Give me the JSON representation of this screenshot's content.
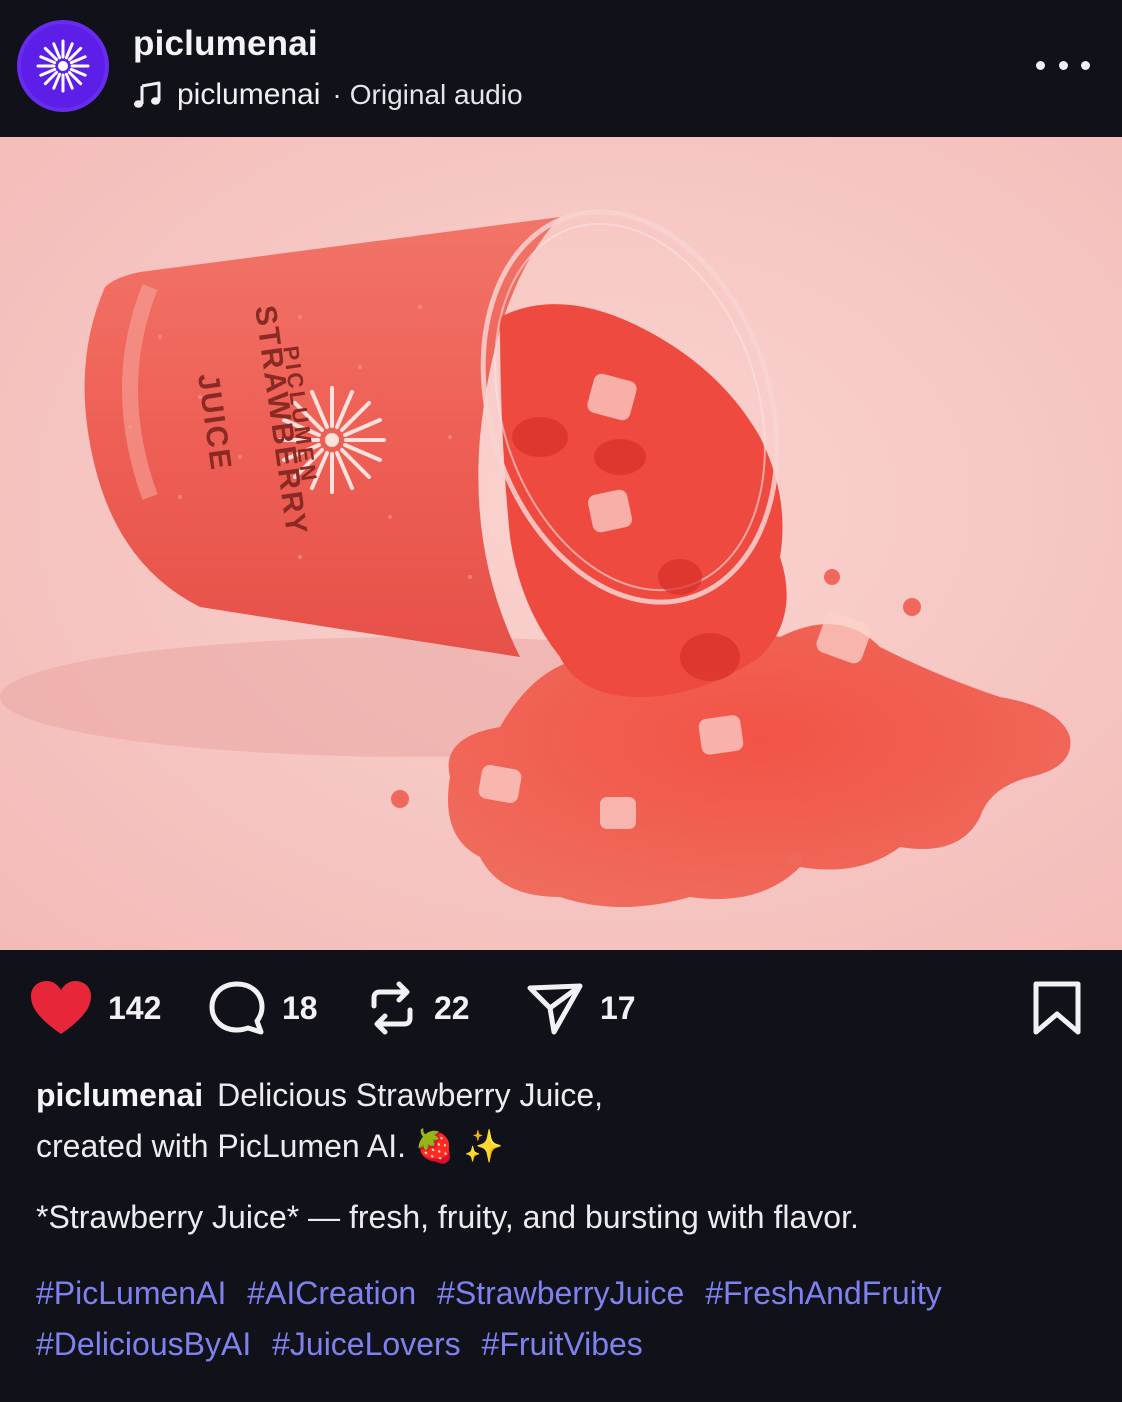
{
  "header": {
    "username": "piclumenai",
    "audio_user": "piclumenai",
    "audio_separator": "·",
    "audio_label": "Original audio",
    "avatar_icon": "sunburst-logo-icon",
    "more_icon": "more-options-icon"
  },
  "media": {
    "label_line1": "PICLUMEN",
    "label_line2": "STRAWBERRY",
    "label_line3": "JUICE"
  },
  "actions": {
    "likes": "142",
    "comments": "18",
    "reposts": "22",
    "shares": "17",
    "liked": true
  },
  "caption": {
    "username": "piclumenai",
    "line1": "Delicious Strawberry Juice,",
    "line2": "created with PicLumen AI. 🍓 ✨",
    "quote": "*Strawberry Juice* — fresh, fruity, and bursting with flavor.",
    "hashtags": [
      "#PicLumenAI",
      "#AICreation",
      "#StrawberryJuice",
      "#FreshAndFruity",
      "#DeliciousByAI",
      "#JuiceLovers",
      "#FruitVibes"
    ]
  },
  "colors": {
    "background": "#101119",
    "accent_link": "#7f82ee",
    "like_red": "#e8263a",
    "avatar_purple": "#6a2bf0",
    "photo_backdrop": "#f6c6c3"
  }
}
